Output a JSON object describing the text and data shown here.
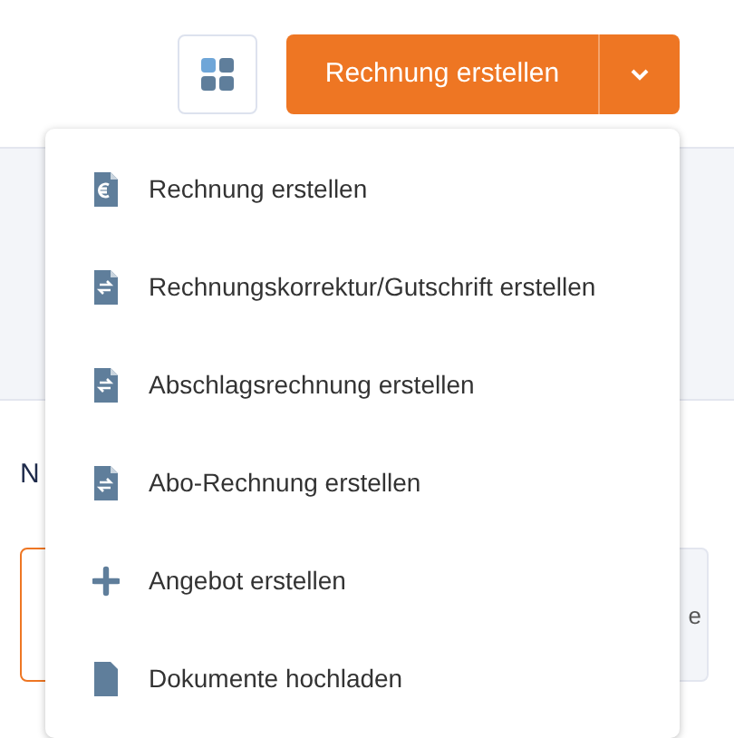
{
  "toolbar": {
    "primary_button": {
      "label": "Rechnung erstellen",
      "expanded": true
    }
  },
  "menu": {
    "items": [
      {
        "kind": "euro-doc",
        "label": "Rechnung erstellen"
      },
      {
        "kind": "correction-doc",
        "label": "Rechnungskorrektur/Gutschrift erstellen"
      },
      {
        "kind": "correction-doc",
        "label": "Abschlagsrechnung erstellen"
      },
      {
        "kind": "recurring-doc",
        "label": "Abo-Rechnung erstellen"
      },
      {
        "kind": "plus",
        "label": "Angebot erstellen"
      },
      {
        "kind": "doc",
        "label": "Dokumente hochladen"
      }
    ]
  },
  "section": {
    "heading": "N",
    "card_2_text": "e"
  }
}
